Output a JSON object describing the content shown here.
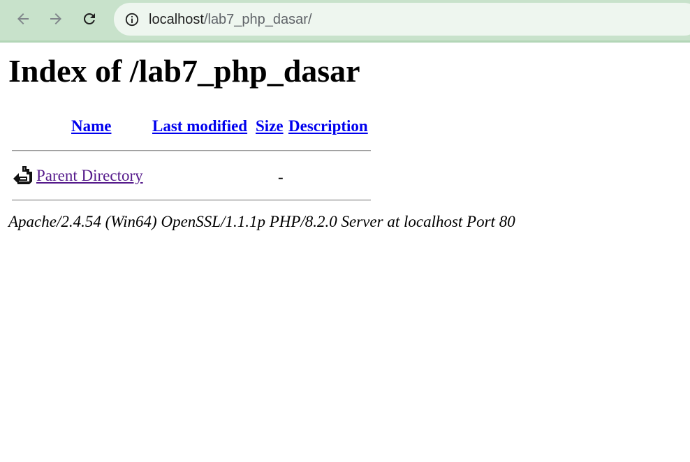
{
  "browser": {
    "back_icon": "arrow-left-icon",
    "forward_icon": "arrow-right-icon",
    "reload_icon": "reload-icon",
    "info_icon": "info-icon",
    "url_host": "localhost",
    "url_path": "/lab7_php_dasar/"
  },
  "page": {
    "title": "Index of /lab7_php_dasar",
    "columns": {
      "name": "Name",
      "last_modified": "Last modified",
      "size": "Size",
      "description": "Description"
    },
    "rows": [
      {
        "icon": "parent-directory-icon",
        "name": "Parent Directory",
        "last_modified": "",
        "size": "-",
        "description": ""
      }
    ],
    "footer": "Apache/2.4.54 (Win64) OpenSSL/1.1.1p PHP/8.2.0 Server at localhost Port 80"
  },
  "colors": {
    "toolbar_bg": "#c8e2cb",
    "omnibox_bg": "#eef6ef",
    "link": "#0000ee",
    "visited_link": "#551a8b"
  }
}
